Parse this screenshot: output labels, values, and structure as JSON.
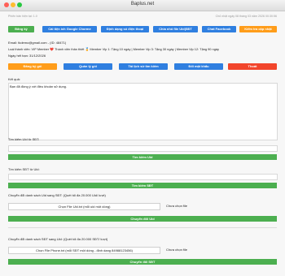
{
  "window": {
    "title": "Baplus.net"
  },
  "header": {
    "version": "Phiên bản hiện tại: 1.0",
    "datetime": "Chủ nhật ngày 08 tháng 03 năm 2026 00:30:56"
  },
  "toolbar": {
    "buttons": [
      {
        "label": "Đăng ký",
        "color": "#4caf50"
      },
      {
        "label": "Cài tiện ích Google Chorme",
        "color": "#2f7fe0"
      },
      {
        "label": "Định dạng số điện thoại",
        "color": "#2f7fe0"
      },
      {
        "label": "Chia nhỏ file Uid|SĐT",
        "color": "#2f7fe0"
      },
      {
        "label": "Chat Facebook",
        "color": "#2f7fe0"
      },
      {
        "label": "Kiểm tra cập nhật",
        "color": "#ff9d1a"
      }
    ]
  },
  "account": {
    "email": "Email: tkdemo@gmail.com - (ID: 48471)",
    "level": "Loại thành viên: VIP Member ❤️  Thành viên thân thiết 🏅 Member Vip 1: Tặng 10 ngày | Member Vip 3: Tặng 30 ngày | Member Vip 12: Tặng 90 ngày",
    "expiry": "Ngày hết hạn: 31/12/2026"
  },
  "account_actions": [
    {
      "label": "Đăng ký gói",
      "color": "#ff9d1a"
    },
    {
      "label": "Quản lý gói",
      "color": "#2f7fe0"
    },
    {
      "label": "Tải lịch sử tìm kiếm",
      "color": "#2f7fe0"
    },
    {
      "label": "Đổi mật khẩu",
      "color": "#2f7fe0"
    },
    {
      "label": "Thoát",
      "color": "#f2452b"
    }
  ],
  "result": {
    "label": "Kết quả:",
    "text": "Bạn đã đồng ý với điều khoản sử dụng."
  },
  "search_uid": {
    "label": "Tìm kiếm Uid từ SĐT:",
    "value": "",
    "button": "Tìm kiếm Uid"
  },
  "search_phone": {
    "label": "Tìm kiếm SĐT từ Uid:",
    "value": "",
    "button": "Tìm kiếm SĐT"
  },
  "convert_uid": {
    "label": "Chuyển đổi danh sách Uid sang SĐT: (Quét tối đa 20.000 Uid/ lượt)",
    "choose": "Chọn File Uid.txt (mỗi uid một dòng)",
    "status": "Chưa chọn file",
    "button": "Chuyển đổi Uid"
  },
  "convert_phone": {
    "label": "Chuyển đổi danh sách SĐT sang Uid: (Quét tối đa 20.000 SĐT/ lượt)",
    "choose": "Chọn File Phone.txt (mỗi SĐT một dòng - định dạng 84988123456)",
    "status": "Chưa chọn file",
    "button": "Chuyển đổi SĐT"
  }
}
